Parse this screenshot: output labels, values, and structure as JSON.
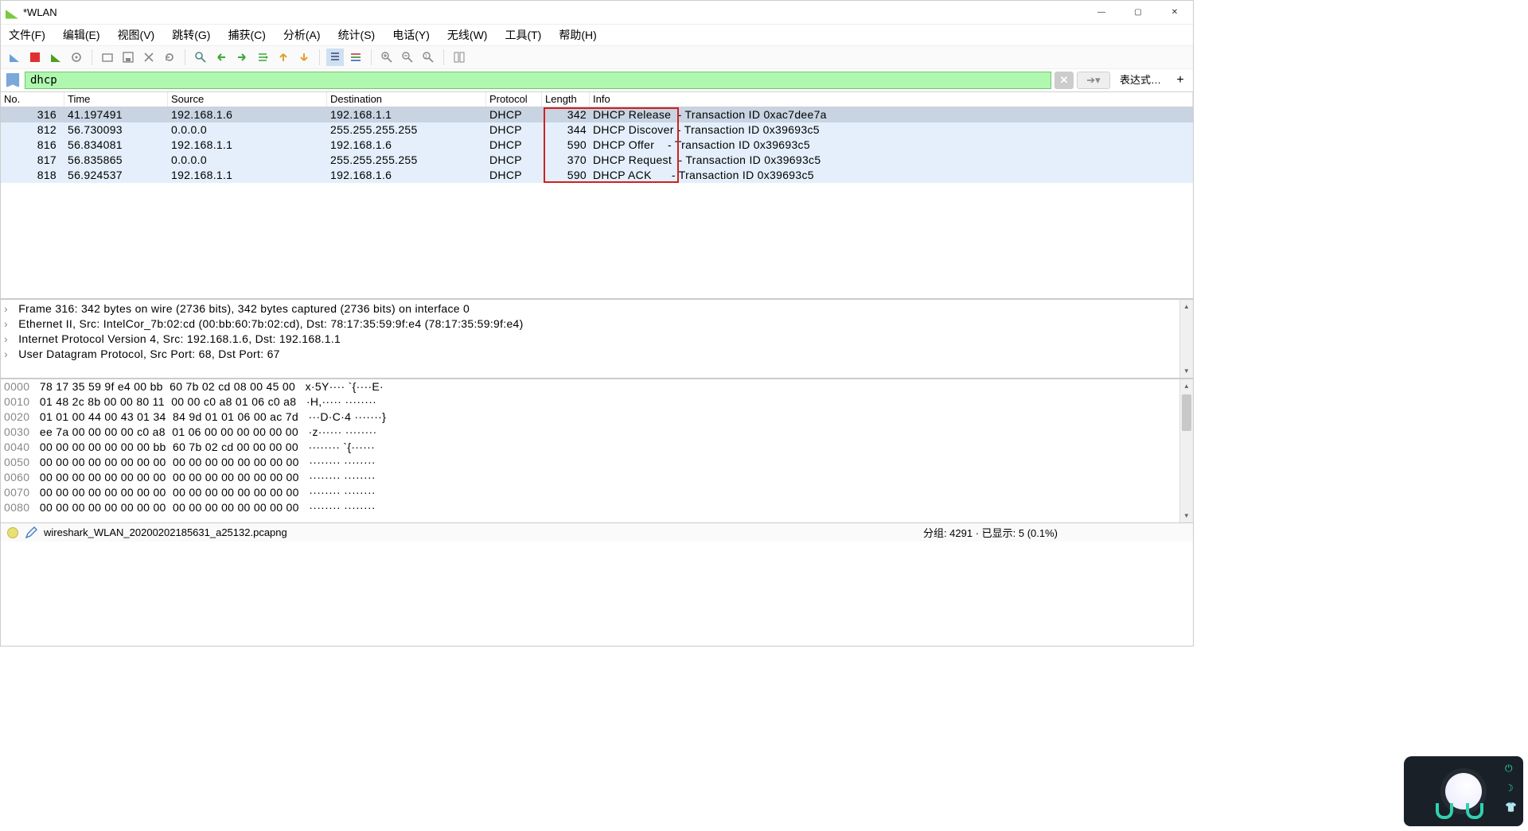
{
  "title": "*WLAN",
  "menu": [
    "文件(F)",
    "编辑(E)",
    "视图(V)",
    "跳转(G)",
    "捕获(C)",
    "分析(A)",
    "统计(S)",
    "电话(Y)",
    "无线(W)",
    "工具(T)",
    "帮助(H)"
  ],
  "filter_value": "dhcp",
  "filter_expr_btn": "表达式…",
  "columns": {
    "no": "No.",
    "time": "Time",
    "source": "Source",
    "destination": "Destination",
    "protocol": "Protocol",
    "length": "Length",
    "info": "Info"
  },
  "packets": [
    {
      "no": "316",
      "time": "41.197491",
      "src": "192.168.1.6",
      "dst": "192.168.1.1",
      "proto": "DHCP",
      "len": "342",
      "info_a": "DHCP Release ",
      "info_b": " - Transaction ID 0xac7dee7a",
      "sel": true,
      "light": false
    },
    {
      "no": "812",
      "time": "56.730093",
      "src": "0.0.0.0",
      "dst": "255.255.255.255",
      "proto": "DHCP",
      "len": "344",
      "info_a": "DHCP Discover",
      "info_b": " - Transaction ID 0x39693c5",
      "sel": false,
      "light": true
    },
    {
      "no": "816",
      "time": "56.834081",
      "src": "192.168.1.1",
      "dst": "192.168.1.6",
      "proto": "DHCP",
      "len": "590",
      "info_a": "DHCP Offer   ",
      "info_b": " - Transaction ID 0x39693c5",
      "sel": false,
      "light": true
    },
    {
      "no": "817",
      "time": "56.835865",
      "src": "0.0.0.0",
      "dst": "255.255.255.255",
      "proto": "DHCP",
      "len": "370",
      "info_a": "DHCP Request ",
      "info_b": " - Transaction ID 0x39693c5",
      "sel": false,
      "light": true
    },
    {
      "no": "818",
      "time": "56.924537",
      "src": "192.168.1.1",
      "dst": "192.168.1.6",
      "proto": "DHCP",
      "len": "590",
      "info_a": "DHCP ACK     ",
      "info_b": " - Transaction ID 0x39693c5",
      "sel": false,
      "light": true
    }
  ],
  "tree": [
    "Frame 316: 342 bytes on wire (2736 bits), 342 bytes captured (2736 bits) on interface 0",
    "Ethernet II, Src: IntelCor_7b:02:cd (00:bb:60:7b:02:cd), Dst: 78:17:35:59:9f:e4 (78:17:35:59:9f:e4)",
    "Internet Protocol Version 4, Src: 192.168.1.6, Dst: 192.168.1.1",
    "User Datagram Protocol, Src Port: 68, Dst Port: 67"
  ],
  "hex": [
    {
      "off": "0000",
      "b": "78 17 35 59 9f e4 00 bb  60 7b 02 cd 08 00 45 00",
      "a": "x·5Y···· `{····E·"
    },
    {
      "off": "0010",
      "b": "01 48 2c 8b 00 00 80 11  00 00 c0 a8 01 06 c0 a8",
      "a": "·H,····· ········"
    },
    {
      "off": "0020",
      "b": "01 01 00 44 00 43 01 34  84 9d 01 01 06 00 ac 7d",
      "a": "···D·C·4 ·······}"
    },
    {
      "off": "0030",
      "b": "ee 7a 00 00 00 00 c0 a8  01 06 00 00 00 00 00 00",
      "a": "·z······ ········"
    },
    {
      "off": "0040",
      "b": "00 00 00 00 00 00 00 bb  60 7b 02 cd 00 00 00 00",
      "a": "········ `{······"
    },
    {
      "off": "0050",
      "b": "00 00 00 00 00 00 00 00  00 00 00 00 00 00 00 00",
      "a": "········ ········"
    },
    {
      "off": "0060",
      "b": "00 00 00 00 00 00 00 00  00 00 00 00 00 00 00 00",
      "a": "········ ········"
    },
    {
      "off": "0070",
      "b": "00 00 00 00 00 00 00 00  00 00 00 00 00 00 00 00",
      "a": "········ ········"
    },
    {
      "off": "0080",
      "b": "00 00 00 00 00 00 00 00  00 00 00 00 00 00 00 00",
      "a": "········ ········"
    }
  ],
  "status_file": "wireshark_WLAN_20200202185631_a25132.pcapng",
  "status_right": "分组: 4291 · 已显示: 5 (0.1%)"
}
